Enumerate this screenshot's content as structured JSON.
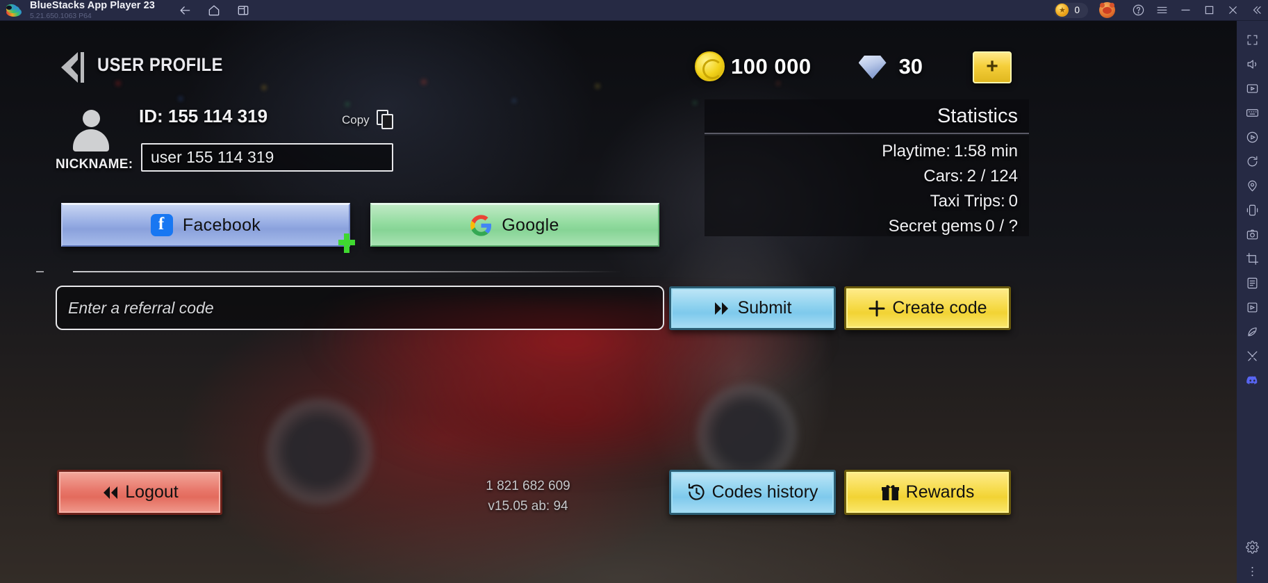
{
  "titlebar": {
    "app_title": "BlueStacks App Player 23",
    "version": "5.21.650.1063  P64",
    "icons": [
      "back-arrow-icon",
      "home-icon",
      "multi-instance-icon"
    ],
    "coin_count": "0",
    "right_icons": [
      "bear-avatar-icon",
      "help-icon",
      "menu-icon",
      "minimize-icon",
      "maximize-icon",
      "close-icon",
      "collapse-icon"
    ]
  },
  "sidebar": {
    "items": [
      {
        "name": "fullscreen-icon"
      },
      {
        "name": "volume-icon"
      },
      {
        "name": "media-icon"
      },
      {
        "name": "keyboard-controls-icon"
      },
      {
        "name": "record-icon"
      },
      {
        "name": "rotate-icon"
      },
      {
        "name": "location-icon"
      },
      {
        "name": "shake-icon"
      },
      {
        "name": "screenshot-icon"
      },
      {
        "name": "crop-icon"
      },
      {
        "name": "script-icon"
      },
      {
        "name": "macro-icon"
      },
      {
        "name": "eco-mode-icon"
      },
      {
        "name": "trim-icon"
      },
      {
        "name": "discord-icon"
      },
      {
        "name": "settings-icon"
      },
      {
        "name": "more-icon"
      }
    ]
  },
  "header": {
    "title": "USER PROFILE",
    "back_icon": "back-arrow-icon",
    "coin_icon": "coin-icon",
    "coin_value": "100 000",
    "gem_icon": "gem-icon",
    "gem_value": "30",
    "plus_label": "+"
  },
  "profile": {
    "avatar_icon": "avatar-icon",
    "id_text": "ID: 155 114 319",
    "copy_label": "Copy",
    "copy_icon": "copy-icon",
    "nickname_label": "NICKNAME:",
    "nickname_value": "user 155 114 319"
  },
  "social": {
    "facebook_label": "Facebook",
    "facebook_icon": "facebook-icon",
    "google_label": "Google",
    "google_icon": "google-icon"
  },
  "referral": {
    "placeholder": "Enter a referral code",
    "value": "",
    "submit_label": "Submit",
    "submit_icon": "double-chevron-right-icon",
    "create_label": "Create code",
    "create_icon": "plus-icon"
  },
  "statistics": {
    "title": "Statistics",
    "rows": [
      {
        "label": "Playtime:",
        "value": "1:58 min"
      },
      {
        "label": "Cars:",
        "value": "2 / 124"
      },
      {
        "label": "Taxi Trips:",
        "value": "0"
      },
      {
        "label": "Secret gems",
        "value": "0 / ?"
      }
    ]
  },
  "footer": {
    "logout_label": "Logout",
    "logout_icon": "double-chevron-left-icon",
    "build_number": "1 821 682 609",
    "build_version": "v15.05 ab: 94",
    "codes_history_label": "Codes history",
    "codes_history_icon": "clock-history-icon",
    "rewards_label": "Rewards",
    "rewards_icon": "gift-icon"
  },
  "colors": {
    "titlebar_bg": "#262a44",
    "accent_yellow": "#f2d334",
    "accent_blue": "#8ed2ef",
    "accent_red": "#e8776a",
    "facebook_blue": "#1877f2"
  }
}
